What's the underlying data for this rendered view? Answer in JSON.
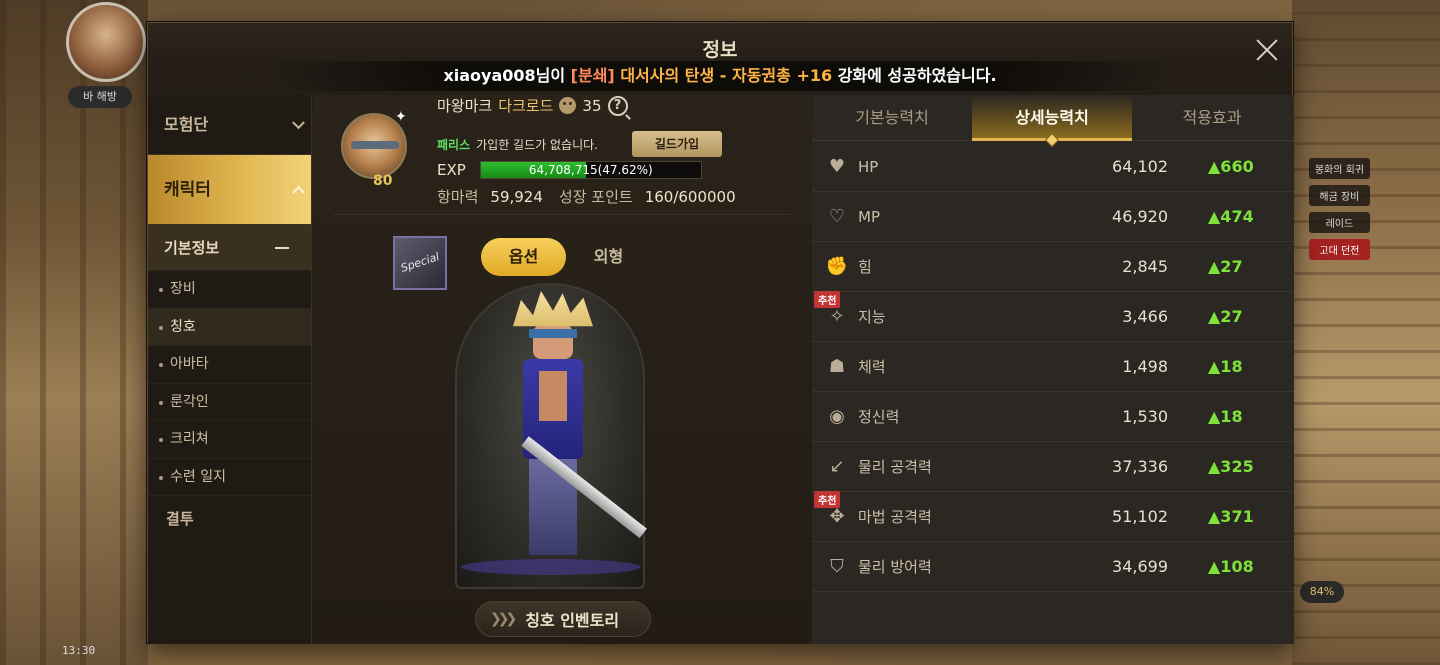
{
  "background": {
    "name_tag": "바 해방",
    "clock": "13:30",
    "right_labels": [
      "봉화의 회귀",
      "해금 장비",
      "레이드",
      "고대 던전"
    ],
    "badge": "84%"
  },
  "window": {
    "title": "정보"
  },
  "notice": {
    "user": "xiaoya008님이 ",
    "tag": "[분쇄]",
    "item": " 대서사의 탄생 - 자동권총 +16",
    "suffix": " 강화에 성공하였습니다."
  },
  "sidebar": {
    "group1": "모험단",
    "group2": "캐릭터",
    "sub": "기본정보",
    "items": [
      "장비",
      "칭호",
      "아바타",
      "룬각인",
      "크리쳐",
      "수련 일지"
    ],
    "bottom": "결투"
  },
  "character": {
    "level": "80",
    "server": "마왕마크",
    "job": "다크로드",
    "fame": "35",
    "guild_tag": "패리스",
    "guild_text": "가입한 길드가 없습니다.",
    "guild_button": "길드가입",
    "exp_label": "EXP",
    "exp_text": "64,708,715(47.62%)",
    "exp_percent": 47.62,
    "power_label": "항마력",
    "power_value": "59,924",
    "growth_label": "성장 포인트",
    "growth_value": "160/600000",
    "toggle_option": "옵션",
    "toggle_look": "외형",
    "inventory_button": "칭호 인벤토리",
    "title_badge_text": "Special"
  },
  "stats": {
    "tabs": [
      "기본능력치",
      "상세능력치",
      "적용효과"
    ],
    "active_tab": 1,
    "recommend_label": "추천",
    "rows": [
      {
        "icon": "heart-filled-icon",
        "name": "HP",
        "value": "64,102",
        "inc": "▲660"
      },
      {
        "icon": "heart-outline-icon",
        "name": "MP",
        "value": "46,920",
        "inc": "▲474"
      },
      {
        "icon": "fist-icon",
        "name": "힘",
        "value": "2,845",
        "inc": "▲27"
      },
      {
        "icon": "sparkle-icon",
        "name": "지능",
        "value": "3,466",
        "inc": "▲27"
      },
      {
        "icon": "torso-icon",
        "name": "체력",
        "value": "1,498",
        "inc": "▲18"
      },
      {
        "icon": "eye-icon",
        "name": "정신력",
        "value": "1,530",
        "inc": "▲18"
      },
      {
        "icon": "sword-icon",
        "name": "물리 공격력",
        "value": "37,336",
        "inc": "▲325"
      },
      {
        "icon": "magic-icon",
        "name": "마법 공격력",
        "value": "51,102",
        "inc": "▲371"
      },
      {
        "icon": "shield-icon",
        "name": "물리 방어력",
        "value": "34,699",
        "inc": "▲108"
      }
    ]
  }
}
